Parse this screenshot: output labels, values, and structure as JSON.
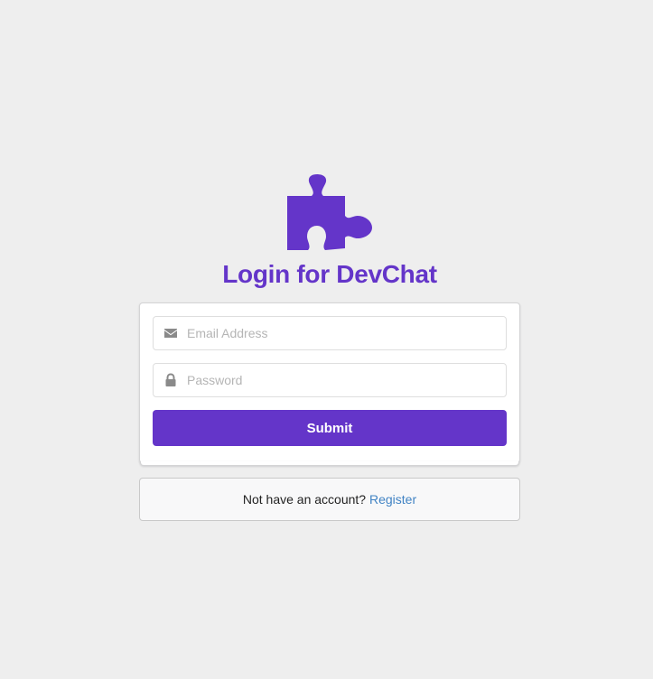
{
  "header": {
    "title": "Login for DevChat",
    "logo_icon": "puzzle-piece-icon",
    "accent_color": "#6435c9"
  },
  "form": {
    "email": {
      "placeholder": "Email Address",
      "value": "",
      "icon": "envelope-icon"
    },
    "password": {
      "placeholder": "Password",
      "value": "",
      "icon": "lock-icon"
    },
    "submit_label": "Submit"
  },
  "footer": {
    "prompt_text": "Not have an account?",
    "register_link": "Register",
    "link_color": "#4183c4"
  }
}
